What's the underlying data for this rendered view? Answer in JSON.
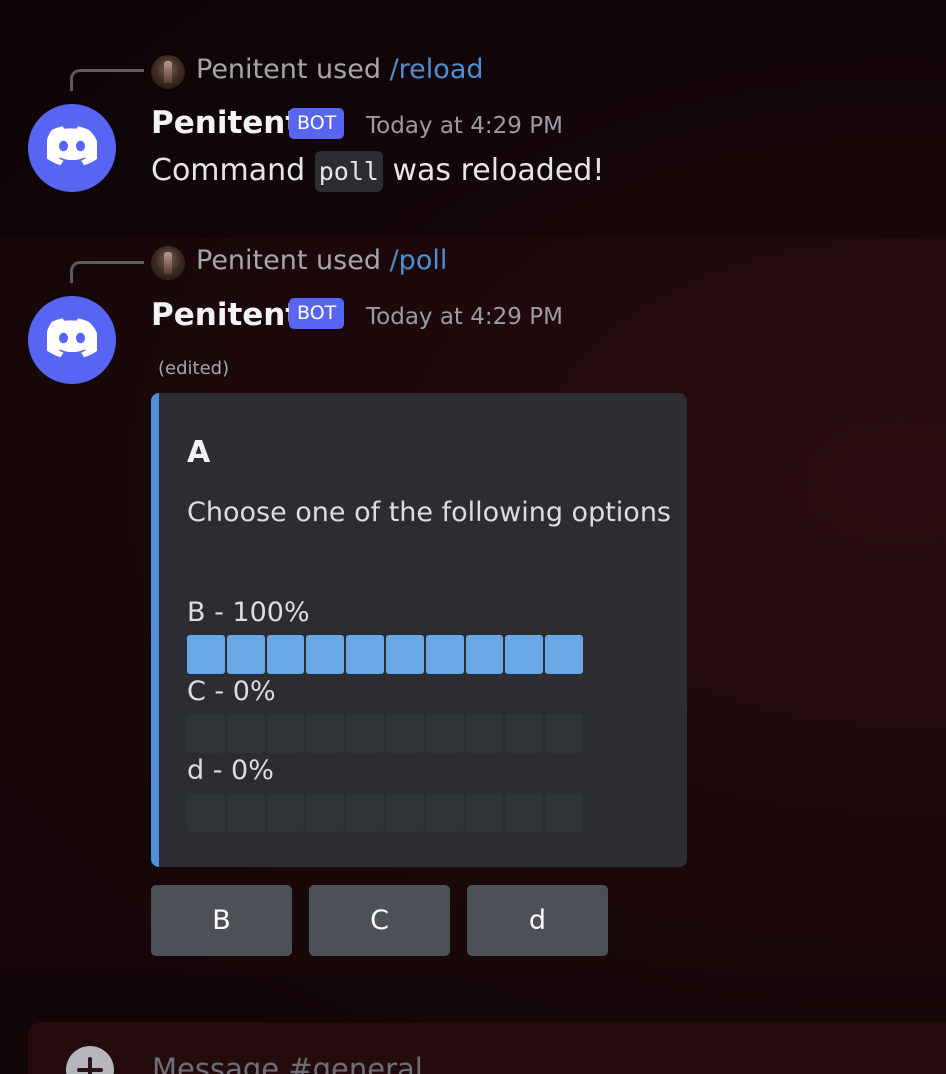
{
  "messages": [
    {
      "reply": {
        "user": "Penitent",
        "used": "used",
        "command": "/reload"
      },
      "author": "Penitent",
      "tag": "BOT",
      "timestamp": "Today at 4:29 PM",
      "content": {
        "before": "Command ",
        "code": "poll",
        "after": " was reloaded!"
      }
    },
    {
      "reply": {
        "user": "Penitent",
        "used": "used",
        "command": "/poll"
      },
      "author": "Penitent",
      "tag": "BOT",
      "timestamp": "Today at 4:29 PM",
      "edited": "(edited)",
      "embed": {
        "accent_color": "#4f8fde",
        "title": "A",
        "description": "Choose one of the following options",
        "options": [
          {
            "label": "B - 100%",
            "fraction": 1.0
          },
          {
            "label": "C - 0%",
            "fraction": 0.0
          },
          {
            "label": "d - 0%",
            "fraction": 0.0
          }
        ]
      },
      "buttons": [
        "B",
        "C",
        "d"
      ]
    }
  ],
  "composer": {
    "placeholder": "Message #general"
  },
  "colors": {
    "blurple": "#5865f2",
    "bar_fill": "#68a8e6",
    "bar_empty": "#2f3438",
    "link": "#4e8fd4"
  },
  "icons": {
    "avatar": "discord-logo-icon",
    "reply_avatar": "user-avatar",
    "composer": "plus-circle-icon"
  }
}
